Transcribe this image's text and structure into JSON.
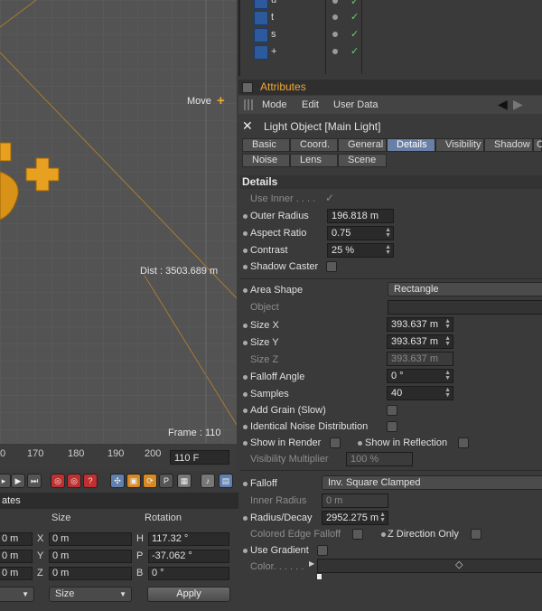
{
  "viewport": {
    "mode_label": "Move",
    "distance": "Dist : 3503.689 m",
    "frame": "Frame : 110"
  },
  "timeline": {
    "ticks": [
      "0",
      "170",
      "180",
      "190",
      "200"
    ],
    "frame_field": "110 F"
  },
  "coordinates": {
    "header": "ates",
    "col_size": "Size",
    "col_rotation": "Rotation",
    "rows": [
      {
        "pos": "0 m",
        "x_label": "X",
        "size": "0 m",
        "r_label": "H",
        "rot": "117.32 °"
      },
      {
        "pos": "0 m",
        "x_label": "Y",
        "size": "0 m",
        "r_label": "P",
        "rot": "-37.062 °"
      },
      {
        "pos": "0 m",
        "x_label": "Z",
        "size": "0 m",
        "r_label": "B",
        "rot": "0 °"
      }
    ],
    "size_dropdown": "Size",
    "apply_label": "Apply"
  },
  "object_list": {
    "items": [
      {
        "name": "u"
      },
      {
        "name": "t"
      },
      {
        "name": "s"
      },
      {
        "name": "+"
      }
    ]
  },
  "attributes": {
    "title": "Attributes",
    "menu": [
      "Mode",
      "Edit",
      "User Data"
    ],
    "object_title": "Light Object [Main Light]",
    "tabs_row1": [
      "Basic",
      "Coord.",
      "General",
      "Details",
      "Visibility",
      "Shadow",
      "C"
    ],
    "tabs_row2": [
      "Noise",
      "Lens",
      "Scene"
    ],
    "section": "Details",
    "use_inner": "Use Inner . . . .",
    "outer_radius": {
      "label": "Outer Radius",
      "value": "196.818 m"
    },
    "aspect_ratio": {
      "label": "Aspect Ratio",
      "value": "0.75"
    },
    "contrast": {
      "label": "Contrast",
      "value": "25 %"
    },
    "shadow_caster": "Shadow Caster",
    "area_shape": {
      "label": "Area Shape",
      "value": "Rectangle"
    },
    "object": "Object",
    "size_x": {
      "label": "Size X",
      "value": "393.637 m"
    },
    "size_y": {
      "label": "Size Y",
      "value": "393.637 m"
    },
    "size_z": {
      "label": "Size Z",
      "value": "393.637 m"
    },
    "falloff_angle": {
      "label": "Falloff Angle",
      "value": "0 °"
    },
    "samples": {
      "label": "Samples",
      "value": "40"
    },
    "add_grain": "Add Grain (Slow)",
    "identical_noise": "Identical Noise Distribution",
    "show_in_render": "Show in Render",
    "show_in_reflection": "Show in Reflection",
    "visibility_multiplier": {
      "label": "Visibility Multiplier",
      "value": "100 %"
    },
    "falloff": {
      "label": "Falloff",
      "value": "Inv. Square Clamped"
    },
    "inner_radius": {
      "label": "Inner Radius",
      "value": "0 m"
    },
    "radius_decay": {
      "label": "Radius/Decay",
      "value": "2952.275 m"
    },
    "colored_edge_falloff": "Colored Edge Falloff",
    "z_direction_only": "Z Direction Only",
    "use_gradient": "Use Gradient",
    "color": "Color. . . . . ."
  },
  "colors": {
    "accent": "#f0a830",
    "viewport_bg": "#525252",
    "active_tab": "#6a7fa5",
    "object_orange": "#e8a020"
  }
}
